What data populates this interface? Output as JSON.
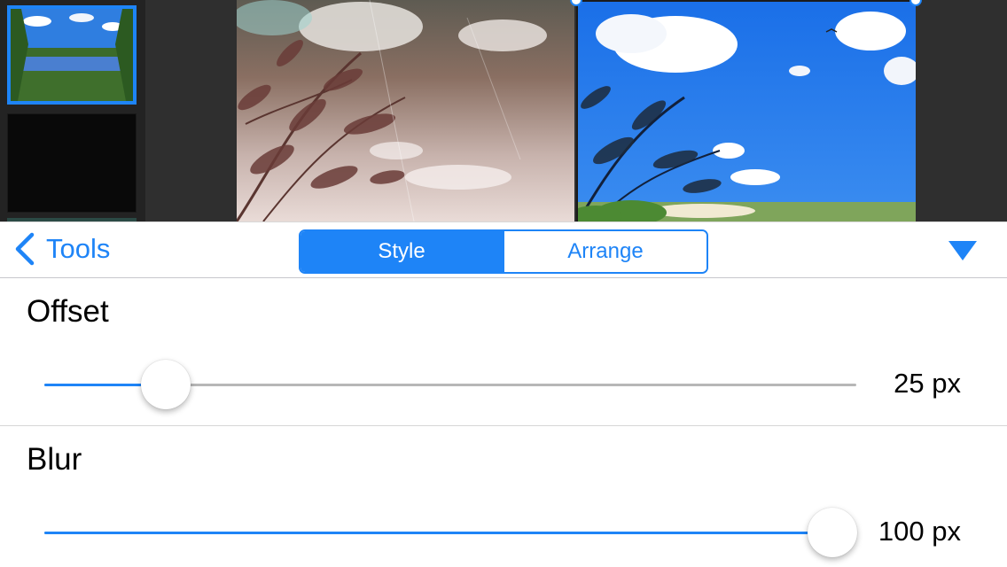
{
  "toolbar": {
    "back_label": "Tools",
    "segments": [
      {
        "label": "Style",
        "active": true
      },
      {
        "label": "Arrange",
        "active": false
      }
    ]
  },
  "settings": [
    {
      "title": "Offset",
      "value_text": "25 px",
      "level": 0.15
    },
    {
      "title": "Blur",
      "value_text": "100 px",
      "level": 0.97
    }
  ],
  "colors": {
    "accent": "#1e84f7",
    "track": "#b7b7b7",
    "canvas_bg": "#2f2f2f"
  },
  "icons": {
    "back": "chevron-left-icon",
    "collapse": "triangle-down-icon"
  }
}
